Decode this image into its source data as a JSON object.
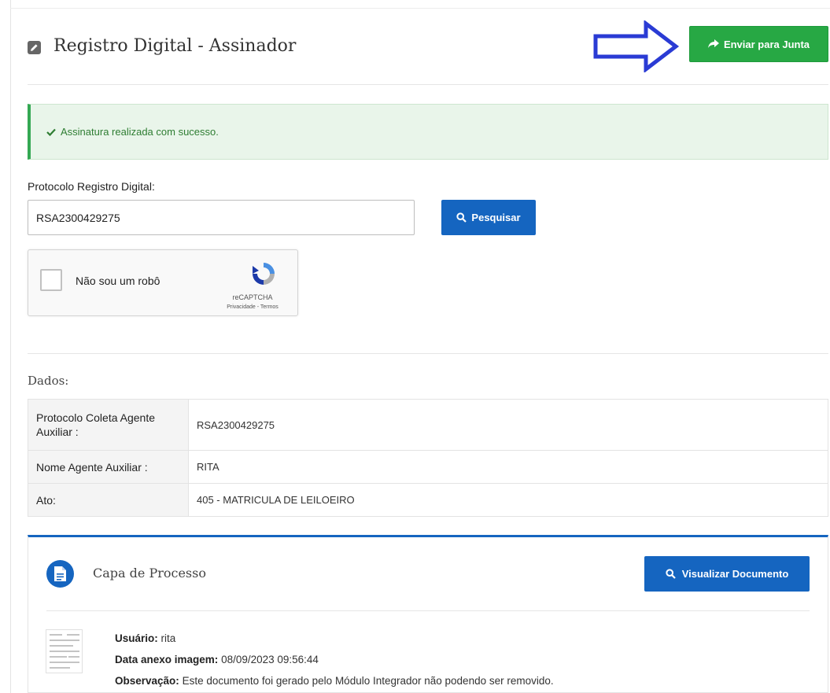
{
  "header": {
    "title": "Registro Digital - Assinador",
    "send_label": "Enviar para Junta",
    "arrow_color": "#2a3bd4"
  },
  "alert": {
    "message": "Assinatura realizada com sucesso."
  },
  "search": {
    "label": "Protocolo Registro Digital:",
    "value": "RSA2300429275",
    "button_label": "Pesquisar"
  },
  "captcha": {
    "label": "Não sou um robô",
    "brand": "reCAPTCHA",
    "links": "Privacidade - Termos"
  },
  "dados": {
    "title": "Dados:",
    "rows": [
      {
        "key": "Protocolo Coleta Agente Auxiliar :",
        "value": "RSA2300429275"
      },
      {
        "key": "Nome Agente Auxiliar :",
        "value": "RITA"
      },
      {
        "key": "Ato:",
        "value": "405 - MATRICULA DE LEILOEIRO"
      }
    ]
  },
  "capa": {
    "title": "Capa de Processo",
    "view_label": "Visualizar Documento",
    "usuario_label": "Usuário:",
    "usuario_value": "rita",
    "data_label": "Data anexo imagem:",
    "data_value": "08/09/2023 09:56:44",
    "obs_label": "Observação:",
    "obs_value": "Este documento foi gerado pelo Módulo Integrador não podendo ser removido."
  },
  "colors": {
    "green": "#27a844",
    "blue": "#1565c0"
  }
}
